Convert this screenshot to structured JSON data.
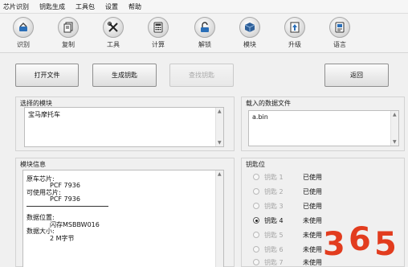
{
  "menu": [
    "芯片识别",
    "钥匙生成",
    "工具包",
    "设置",
    "帮助"
  ],
  "toolbar": [
    {
      "label": "识别",
      "icon": "scan-icon"
    },
    {
      "label": "复制",
      "icon": "copy-icon"
    },
    {
      "label": "工具",
      "icon": "tools-icon"
    },
    {
      "label": "计算",
      "icon": "calculator-icon"
    },
    {
      "label": "解锁",
      "icon": "unlock-icon"
    },
    {
      "label": "模块",
      "icon": "module-icon"
    },
    {
      "label": "升级",
      "icon": "upgrade-icon"
    },
    {
      "label": "语言",
      "icon": "language-icon"
    }
  ],
  "buttons": {
    "open_file": "打开文件",
    "generate_key": "生成钥匙",
    "find_key": "查找钥匙",
    "back": "返回"
  },
  "selected_module": {
    "title": "选择的模块",
    "value": "宝马摩托车"
  },
  "loaded_file": {
    "title": "载入的数据文件",
    "value": "a.bin"
  },
  "module_info": {
    "title": "模块信息",
    "original_chip_label": "原车芯片:",
    "original_chip_value": "PCF 7936",
    "usable_chip_label": "可使用芯片:",
    "usable_chip_value": "PCF 7936",
    "data_location_label": "数据位置:",
    "data_location_value": "闪存MSBBW016",
    "data_size_label": "数据大小:",
    "data_size_value": "2 M字节"
  },
  "key_slots": {
    "title": "钥匙位",
    "items": [
      {
        "label": "钥匙 1",
        "status": "已使用",
        "checked": false
      },
      {
        "label": "钥匙 2",
        "status": "已使用",
        "checked": false
      },
      {
        "label": "钥匙 3",
        "status": "已使用",
        "checked": false
      },
      {
        "label": "钥匙 4",
        "status": "未使用",
        "checked": true
      },
      {
        "label": "钥匙 5",
        "status": "未使用",
        "checked": false
      },
      {
        "label": "钥匙 6",
        "status": "未使用",
        "checked": false
      },
      {
        "label": "钥匙 7",
        "status": "未使用",
        "checked": false
      }
    ]
  },
  "watermark": {
    "digits": [
      "3",
      "6",
      "5"
    ]
  },
  "colors": {
    "accent": "#1f78c8",
    "watermark": "#e23c1e"
  }
}
